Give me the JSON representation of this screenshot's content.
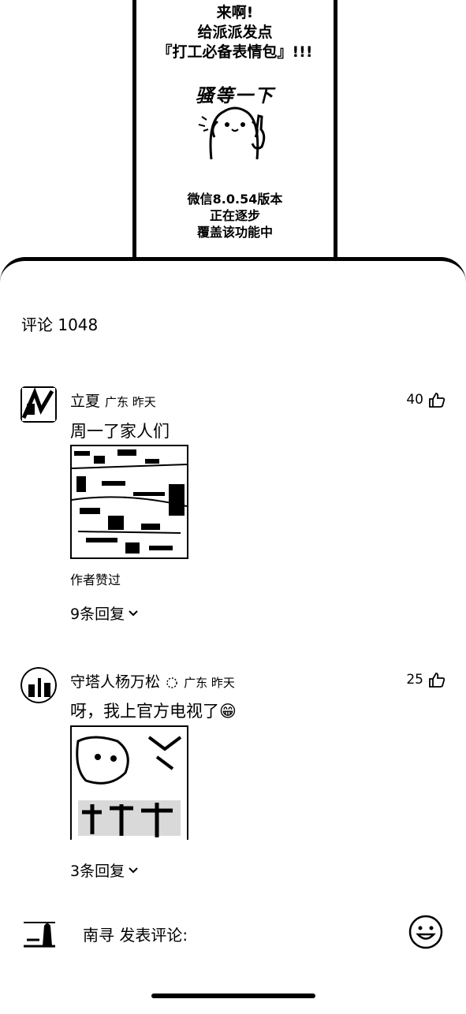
{
  "banner": {
    "title_lines": [
      "来啊!",
      "给派派发点",
      "『打工必备表情包』!!!"
    ],
    "sticker_text": "骚等一下",
    "notice_lines": [
      "微信8.0.54版本",
      "正在逐步",
      "覆盖该功能中"
    ]
  },
  "comments_header": "评论 1048",
  "comments": [
    {
      "name": "立夏",
      "meta": "广东 昨天",
      "likes": "40",
      "text": "周一了家人们",
      "author_liked": "作者赞过",
      "replies": "9条回复"
    },
    {
      "name": "守塔人杨万松",
      "meta": "广东 昨天",
      "likes": "25",
      "text": "呀，我上官方电视了😁",
      "replies": "3条回复"
    }
  ],
  "composer": {
    "placeholder": "南寻 发表评论:"
  }
}
